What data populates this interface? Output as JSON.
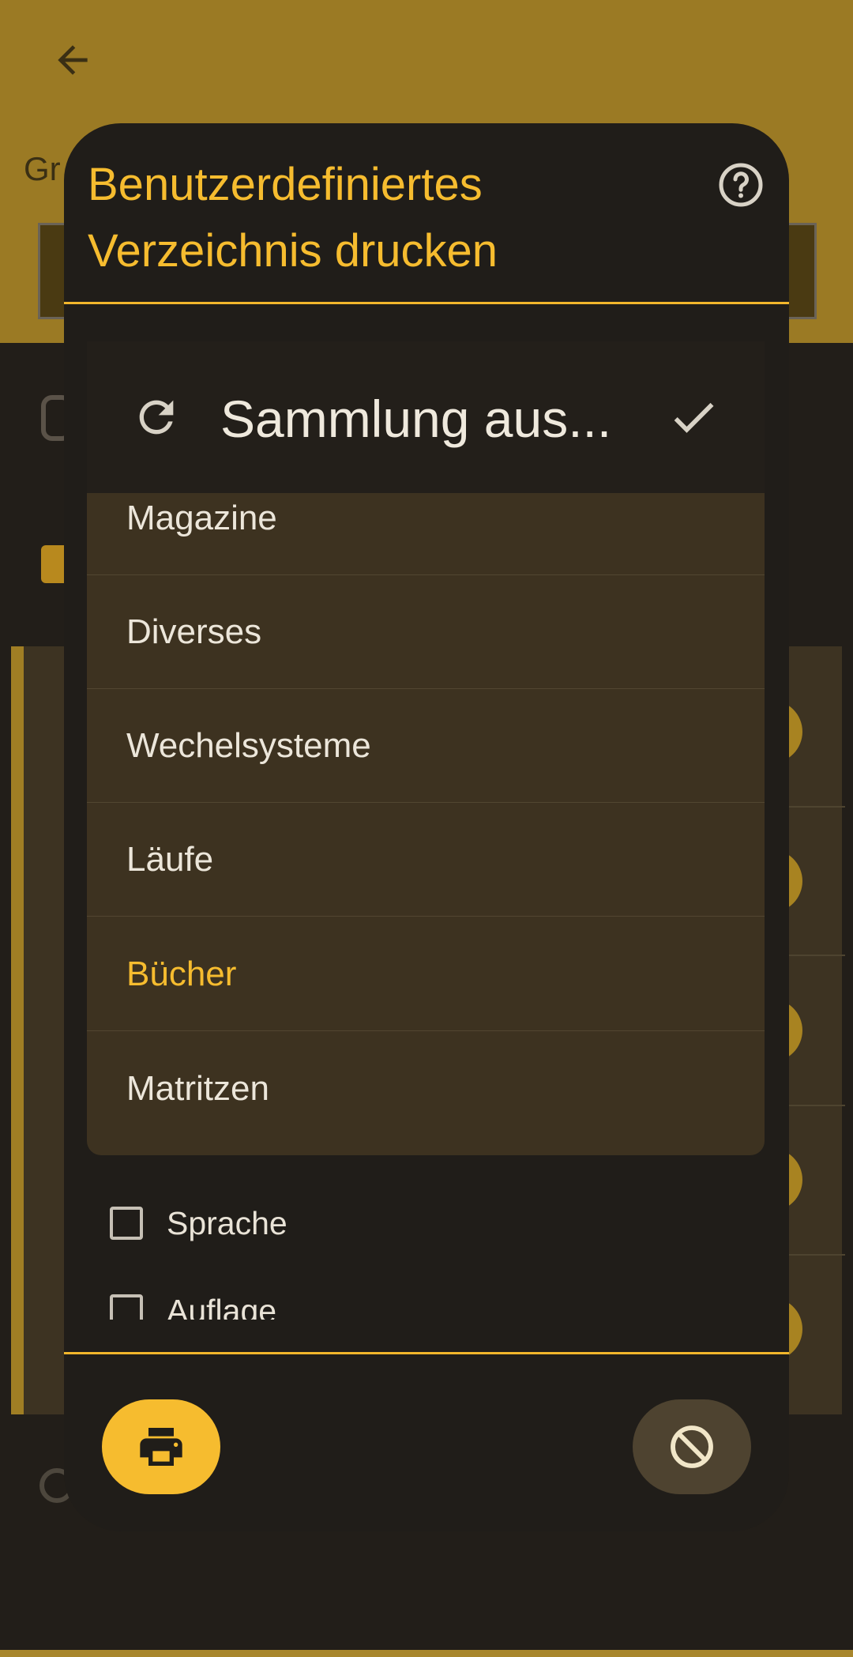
{
  "background": {
    "title_partial": "Gr"
  },
  "dialog": {
    "title": "Benutzerdefiniertes Verzeichnis drucken",
    "checkboxes": [
      {
        "label": "Sprache",
        "checked": false
      },
      {
        "label": "Auflage",
        "checked": false
      }
    ],
    "buttons": {
      "print_icon": "printer-icon",
      "cancel_icon": "block-icon"
    },
    "help_icon": "help-circle-icon"
  },
  "dropdown": {
    "title": "Sammlung aus...",
    "refresh_icon": "refresh-icon",
    "confirm_icon": "check-icon",
    "options": [
      {
        "label": "Magazine",
        "selected": false
      },
      {
        "label": "Diverses",
        "selected": false
      },
      {
        "label": "Wechelsysteme",
        "selected": false
      },
      {
        "label": "Läufe",
        "selected": false
      },
      {
        "label": "Bücher",
        "selected": true
      },
      {
        "label": "Matritzen",
        "selected": false
      }
    ]
  },
  "colors": {
    "accent": "#f6bc2f",
    "header_bg": "#9b7a24",
    "dialog_bg": "#201d19",
    "popup_bg": "#3d3220",
    "text": "#ece6da"
  }
}
